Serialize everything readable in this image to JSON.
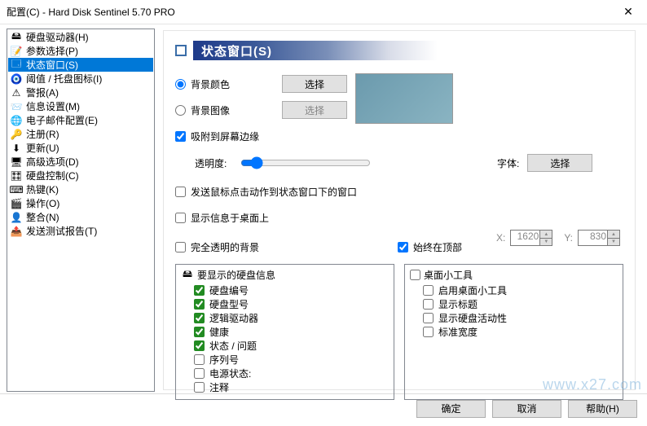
{
  "titlebar": {
    "text": "配置(C)  -  Hard Disk Sentinel 5.70 PRO"
  },
  "sidebar": {
    "items": [
      {
        "label": "硬盘驱动器(H)",
        "icon": "🖴"
      },
      {
        "label": "参数选择(P)",
        "icon": "📝"
      },
      {
        "label": "状态窗口(S)",
        "icon": "🗔",
        "selected": true
      },
      {
        "label": "阈值 / 托盘图标(I)",
        "icon": "🧿"
      },
      {
        "label": "警报(A)",
        "icon": "⚠"
      },
      {
        "label": "信息设置(M)",
        "icon": "📨"
      },
      {
        "label": "电子邮件配置(E)",
        "icon": "🌐"
      },
      {
        "label": "注册(R)",
        "icon": "🔑"
      },
      {
        "label": "更新(U)",
        "icon": "⬇"
      },
      {
        "label": "高级选项(D)",
        "icon": "🖥"
      },
      {
        "label": "硬盘控制(C)",
        "icon": "🎛"
      },
      {
        "label": "热键(K)",
        "icon": "⌨"
      },
      {
        "label": "操作(O)",
        "icon": "🎬"
      },
      {
        "label": "整合(N)",
        "icon": "👤"
      },
      {
        "label": "发送测试报告(T)",
        "icon": "📤"
      }
    ]
  },
  "section": {
    "title": "状态窗口(S)"
  },
  "options": {
    "bg_color_label": "背景颜色",
    "bg_image_label": "背景图像",
    "select_btn": "选择",
    "snap_edge_label": "吸附到屏幕边缘",
    "opacity_label": "透明度:",
    "font_label": "字体:",
    "send_mouse_label": "发送鼠标点击动作到状态窗口下的窗口",
    "show_on_desktop_label": "显示信息于桌面上",
    "transparent_bg_label": "完全透明的背景",
    "always_top_label": "始终在顶部",
    "x_label": "X:",
    "y_label": "Y:",
    "x_value": "1620",
    "y_value": "830"
  },
  "pane_left": {
    "title": "要显示的硬盘信息",
    "items": [
      {
        "label": "硬盘编号",
        "checked": true
      },
      {
        "label": "硬盘型号",
        "checked": true
      },
      {
        "label": "逻辑驱动器",
        "checked": true
      },
      {
        "label": "健康",
        "checked": true
      },
      {
        "label": "状态 / 问题",
        "checked": true
      },
      {
        "label": "序列号",
        "checked": false
      },
      {
        "label": "电源状态:",
        "checked": false
      },
      {
        "label": "注释",
        "checked": false
      }
    ]
  },
  "pane_right": {
    "title": "桌面小工具",
    "items": [
      {
        "label": "启用桌面小工具",
        "checked": false
      },
      {
        "label": "显示标题",
        "checked": false
      },
      {
        "label": "显示硬盘活动性",
        "checked": false
      },
      {
        "label": "标准宽度",
        "checked": false
      }
    ]
  },
  "footer": {
    "ok": "确定",
    "cancel": "取消",
    "help": "帮助(H)"
  },
  "watermark": "www.x27.com"
}
